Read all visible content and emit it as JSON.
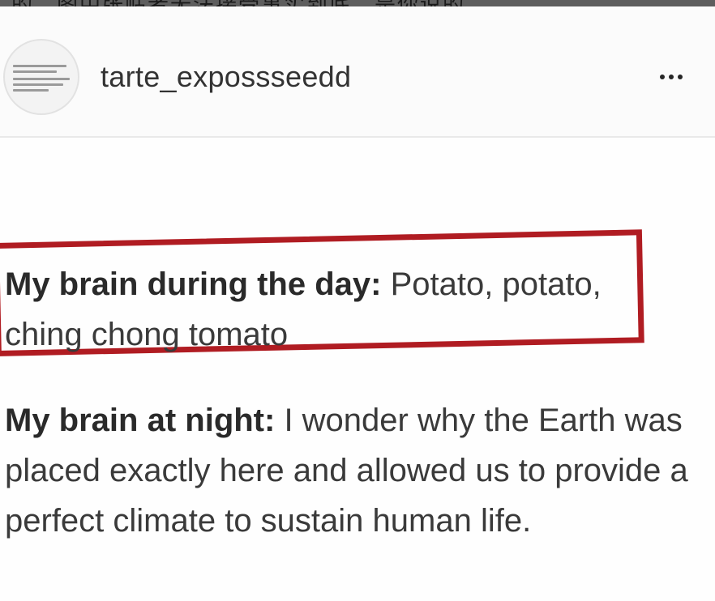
{
  "top_strip": {
    "cut_text": "的…图中张贴者无法接受事实到底，是你说的。"
  },
  "header": {
    "username": "tarte_expossseedd",
    "more_icon": "more-horizontal-icon"
  },
  "post": {
    "para1": {
      "label": "My brain during the day:",
      "text": " Potato, potato, ching chong tomato"
    },
    "para2": {
      "label": "My brain at night:",
      "text": " I wonder why the Earth was placed exactly here and allowed us to provide a perfect climate to sustain human life."
    },
    "highlight_color": "#b01c22"
  }
}
